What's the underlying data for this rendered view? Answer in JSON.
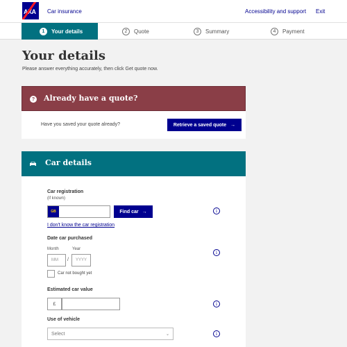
{
  "header": {
    "brand": "Car insurance",
    "links": {
      "accessibility": "Accessibility and support",
      "exit": "Exit"
    },
    "logo_text": "AXA"
  },
  "steps": [
    {
      "num": "1",
      "label": "Your details",
      "active": true
    },
    {
      "num": "2",
      "label": "Quote",
      "active": false
    },
    {
      "num": "3",
      "label": "Summary",
      "active": false
    },
    {
      "num": "4",
      "label": "Payment",
      "active": false
    }
  ],
  "page": {
    "title": "Your details",
    "subtitle": "Please answer everything accurately, then click Get quote now."
  },
  "quote_panel": {
    "title": "Already have a quote?",
    "question": "Have you saved your quote already?",
    "button": "Retrieve a saved quote",
    "button_icon": "arrow-right-icon"
  },
  "car_panel": {
    "title": "Car details",
    "icon": "car-icon",
    "registration": {
      "label": "Car registration",
      "sublabel": "(if known)",
      "plate_prefix": "GB",
      "value": "",
      "find_button": "Find car",
      "unknown_link": "I don't know the car registration"
    },
    "date_purchased": {
      "label": "Date car purchased",
      "month_label": "Month",
      "year_label": "Year",
      "month_placeholder": "MM",
      "year_placeholder": "YYYY",
      "separator": "/",
      "checkbox_label": "Car not bought yet"
    },
    "value": {
      "label": "Estimated car value",
      "currency": "£"
    },
    "use": {
      "label": "Use of vehicle",
      "placeholder": "Select"
    }
  },
  "colors": {
    "navy": "#00008f",
    "teal": "#027180",
    "maroon": "#8a3e47",
    "axa_red": "#ff1721"
  }
}
